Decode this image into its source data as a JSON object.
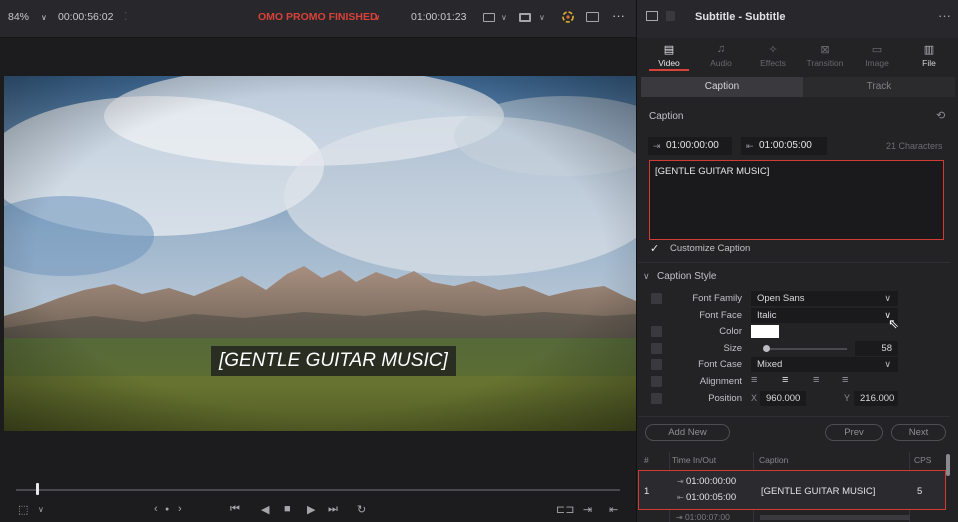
{
  "topbar": {
    "zoom": "84%",
    "timecode_left": "00:00:56:02",
    "project_title": "OMO PROMO FINISHED",
    "timecode_right": "01:00:01:23",
    "more_label": "···"
  },
  "video": {
    "caption_text": "[GENTLE GUITAR MUSIC]"
  },
  "inspector": {
    "title": "Subtitle - Subtitle",
    "more_label": "···",
    "tabs": [
      {
        "label": "Video",
        "icon": "video-icon",
        "active": true
      },
      {
        "label": "Audio",
        "icon": "audio-icon",
        "active": false
      },
      {
        "label": "Effects",
        "icon": "effects-icon",
        "active": false
      },
      {
        "label": "Transition",
        "icon": "transition-icon",
        "active": false
      },
      {
        "label": "Image",
        "icon": "image-icon",
        "active": false
      },
      {
        "label": "File",
        "icon": "file-icon",
        "active": false
      }
    ],
    "subtabs": {
      "caption": "Caption",
      "track": "Track"
    },
    "caption": {
      "section_title": "Caption",
      "start_tc": "01:00:00:00",
      "end_tc": "01:00:05:00",
      "char_count": "21 Characters",
      "text": "[GENTLE GUITAR MUSIC]",
      "customize_label": "Customize Caption",
      "customize_checked": true
    },
    "style": {
      "section_title": "Caption Style",
      "font_family_label": "Font Family",
      "font_family": "Open Sans",
      "font_face_label": "Font Face",
      "font_face": "Italic",
      "color_label": "Color",
      "color_value": "#ffffff",
      "size_label": "Size",
      "size_value": "58",
      "font_case_label": "Font Case",
      "font_case": "Mixed",
      "alignment_label": "Alignment",
      "position_label": "Position",
      "pos_x_label": "X",
      "pos_x": "960.000",
      "pos_y_label": "Y",
      "pos_y": "216.000"
    },
    "buttons": {
      "add_new": "Add New",
      "prev": "Prev",
      "next": "Next"
    },
    "table": {
      "headers": {
        "num": "#",
        "time": "Time In/Out",
        "caption": "Caption",
        "cps": "CPS"
      },
      "rows": [
        {
          "num": "1",
          "in": "01:00:00:00",
          "out": "01:00:05:00",
          "caption": "[GENTLE GUITAR MUSIC]",
          "cps": "5"
        },
        {
          "num": "",
          "in": "01:00:07:00",
          "out": "",
          "caption": "",
          "cps": ""
        }
      ]
    }
  },
  "colors": {
    "accent": "#d8423a",
    "panel": "#232326",
    "field": "#1a1a1c"
  }
}
